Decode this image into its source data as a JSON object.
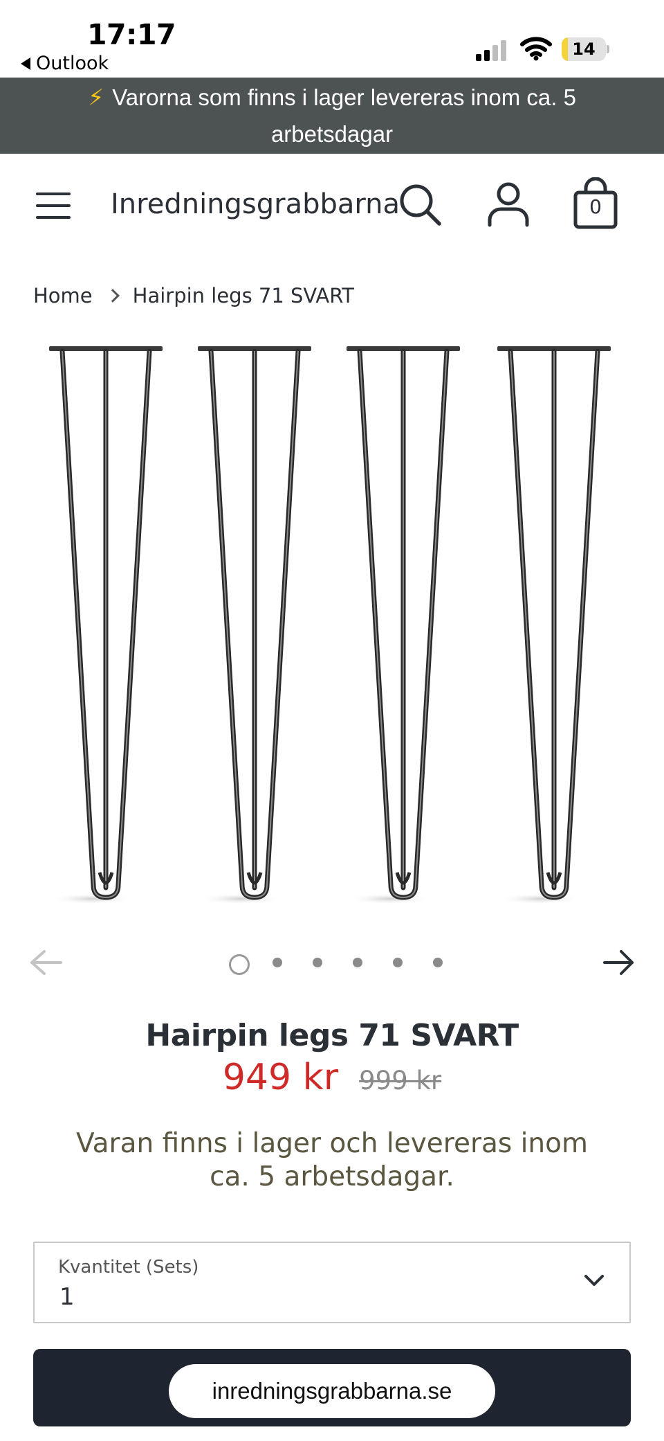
{
  "status_bar": {
    "time": "17:17",
    "back_label": "Outlook",
    "battery_level": "14",
    "battery_fraction": 0.14,
    "battery_color": "#f5d33a"
  },
  "announcement": {
    "icon": "lightning-bolt-icon",
    "text": "Varorna som finns i lager levereras inom ca. 5 arbetsdagar"
  },
  "header": {
    "brand": "Inredningsgrabbarna",
    "menu_icon": "hamburger-menu-icon",
    "search_icon": "search-icon",
    "account_icon": "user-icon",
    "cart_icon": "shopping-bag-icon",
    "cart_count": "0"
  },
  "breadcrumb": {
    "home": "Home",
    "current": "Hairpin legs 71 SVART"
  },
  "gallery": {
    "image_count": 6,
    "active_index": 0,
    "prev_icon": "arrow-left-icon",
    "next_icon": "arrow-right-icon"
  },
  "product": {
    "title": "Hairpin legs 71 SVART",
    "price": "949 kr",
    "compare_price": "999 kr",
    "sale_color": "#cf2a27",
    "stock_note": "Varan finns i lager och levereras inom ca. 5 arbetsdagar."
  },
  "quantity": {
    "label": "Kvantitet (Sets)",
    "value": "1",
    "chevron_icon": "chevron-down-icon"
  },
  "browser": {
    "url": "inredningsgrabbarna.se"
  },
  "colors": {
    "announcement_bg": "#4d5253",
    "cta_bg": "#1f2530",
    "text": "#2b2f36"
  }
}
